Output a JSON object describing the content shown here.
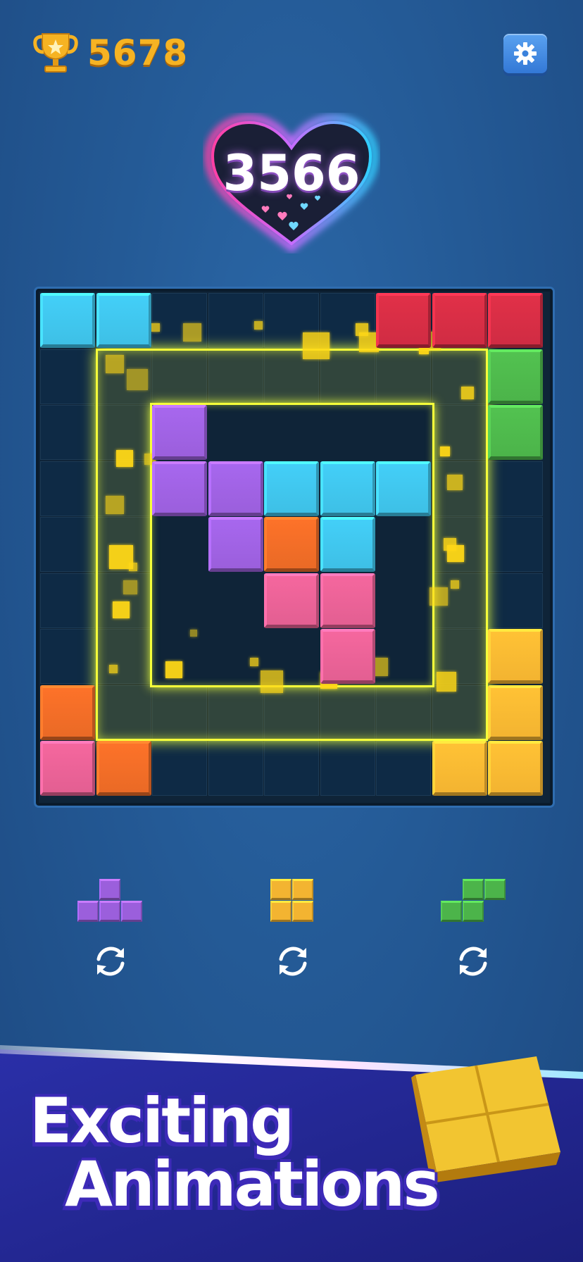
{
  "header": {
    "best_score": "5678",
    "trophy_icon": "trophy-icon",
    "settings_icon": "gear-icon"
  },
  "current_score": "3566",
  "board": {
    "size": 9,
    "blocks": [
      {
        "r": 0,
        "c": 0,
        "color": "cyan"
      },
      {
        "r": 0,
        "c": 1,
        "color": "cyan"
      },
      {
        "r": 0,
        "c": 6,
        "color": "red"
      },
      {
        "r": 0,
        "c": 7,
        "color": "red"
      },
      {
        "r": 0,
        "c": 8,
        "color": "red"
      },
      {
        "r": 1,
        "c": 8,
        "color": "green"
      },
      {
        "r": 2,
        "c": 8,
        "color": "green"
      },
      {
        "r": 2,
        "c": 2,
        "color": "purple"
      },
      {
        "r": 3,
        "c": 2,
        "color": "purple"
      },
      {
        "r": 3,
        "c": 3,
        "color": "purple"
      },
      {
        "r": 3,
        "c": 4,
        "color": "cyan"
      },
      {
        "r": 3,
        "c": 5,
        "color": "cyan"
      },
      {
        "r": 3,
        "c": 6,
        "color": "cyan"
      },
      {
        "r": 4,
        "c": 3,
        "color": "purple"
      },
      {
        "r": 4,
        "c": 4,
        "color": "orange"
      },
      {
        "r": 4,
        "c": 5,
        "color": "cyan"
      },
      {
        "r": 5,
        "c": 4,
        "color": "pink"
      },
      {
        "r": 5,
        "c": 5,
        "color": "pink"
      },
      {
        "r": 6,
        "c": 5,
        "color": "pink"
      },
      {
        "r": 6,
        "c": 8,
        "color": "yellow"
      },
      {
        "r": 7,
        "c": 0,
        "color": "orange"
      },
      {
        "r": 7,
        "c": 8,
        "color": "yellow"
      },
      {
        "r": 8,
        "c": 0,
        "color": "pink"
      },
      {
        "r": 8,
        "c": 1,
        "color": "orange"
      },
      {
        "r": 8,
        "c": 7,
        "color": "yellow"
      },
      {
        "r": 8,
        "c": 8,
        "color": "yellow"
      }
    ]
  },
  "tray": [
    {
      "name": "t-piece",
      "color": "purple",
      "cells": [
        [
          0,
          1
        ],
        [
          1,
          0
        ],
        [
          1,
          1
        ],
        [
          1,
          2
        ]
      ]
    },
    {
      "name": "o-piece",
      "color": "yellow",
      "cells": [
        [
          0,
          0
        ],
        [
          0,
          1
        ],
        [
          1,
          0
        ],
        [
          1,
          1
        ]
      ]
    },
    {
      "name": "s-piece",
      "color": "green",
      "cells": [
        [
          0,
          1
        ],
        [
          0,
          2
        ],
        [
          1,
          0
        ],
        [
          1,
          1
        ]
      ]
    }
  ],
  "colors": {
    "cyan": "#3ec0e6",
    "red": "#d02c43",
    "green": "#4cb44a",
    "purple": "#9b5fdc",
    "orange": "#ea6a26",
    "pink": "#e35f92",
    "yellow": "#f3b431"
  },
  "banner": {
    "line1": "Exciting",
    "line2": "Animations"
  }
}
